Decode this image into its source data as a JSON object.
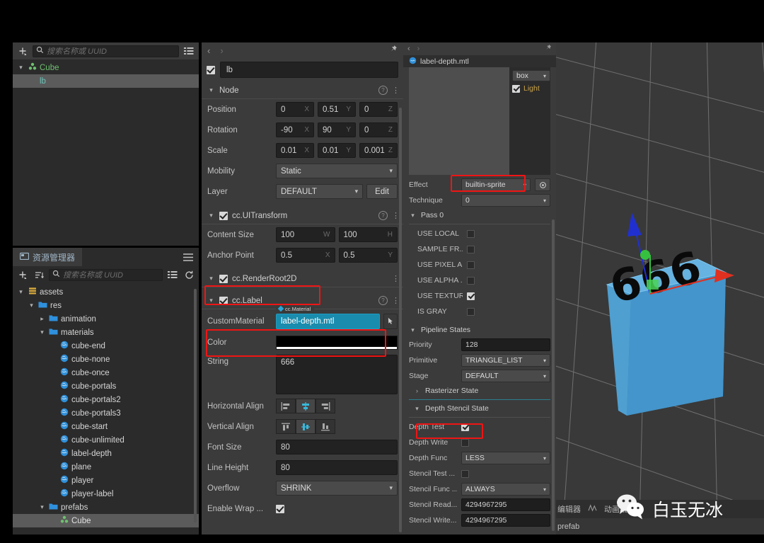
{
  "app": {
    "title": "Cocos Creator Editor"
  },
  "hierarchy": {
    "search_placeholder": "搜索名称或 UUID",
    "add_icon": "plus-icon",
    "search_icon": "search-icon",
    "list_icon": "list-view-icon",
    "nodes": [
      {
        "label": "Cube",
        "icon": "node-icon",
        "arrow": "chevron-down",
        "depth": 0,
        "selected": false
      },
      {
        "label": "lb",
        "icon": "",
        "arrow": "",
        "depth": 1,
        "selected": true
      }
    ]
  },
  "assets": {
    "tab_label": "资源管理器",
    "menu_icon": "hamburger-icon",
    "search_placeholder": "搜索名称或 UUID",
    "add_icon": "plus-icon",
    "sort_icon": "sort-icon",
    "search_icon": "search-icon",
    "list_icon": "list-view-icon",
    "refresh_icon": "refresh-icon",
    "tree": [
      {
        "label": "assets",
        "icon": "assets-icon",
        "arrow": "chevron-down",
        "depth": 0,
        "selected": false
      },
      {
        "label": "res",
        "icon": "folder-icon",
        "arrow": "chevron-down",
        "depth": 1,
        "selected": false
      },
      {
        "label": "animation",
        "icon": "folder-icon",
        "arrow": "chevron-right",
        "depth": 2,
        "selected": false
      },
      {
        "label": "materials",
        "icon": "folder-icon",
        "arrow": "chevron-down",
        "depth": 2,
        "selected": false
      },
      {
        "label": "cube-end",
        "icon": "material-icon",
        "arrow": "",
        "depth": 3,
        "selected": false
      },
      {
        "label": "cube-none",
        "icon": "material-icon",
        "arrow": "",
        "depth": 3,
        "selected": false
      },
      {
        "label": "cube-once",
        "icon": "material-icon",
        "arrow": "",
        "depth": 3,
        "selected": false
      },
      {
        "label": "cube-portals",
        "icon": "material-icon",
        "arrow": "",
        "depth": 3,
        "selected": false
      },
      {
        "label": "cube-portals2",
        "icon": "material-icon",
        "arrow": "",
        "depth": 3,
        "selected": false
      },
      {
        "label": "cube-portals3",
        "icon": "material-icon",
        "arrow": "",
        "depth": 3,
        "selected": false
      },
      {
        "label": "cube-start",
        "icon": "material-icon",
        "arrow": "",
        "depth": 3,
        "selected": false
      },
      {
        "label": "cube-unlimited",
        "icon": "material-icon",
        "arrow": "",
        "depth": 3,
        "selected": false
      },
      {
        "label": "label-depth",
        "icon": "material-icon",
        "arrow": "",
        "depth": 3,
        "selected": false
      },
      {
        "label": "plane",
        "icon": "material-icon",
        "arrow": "",
        "depth": 3,
        "selected": false
      },
      {
        "label": "player",
        "icon": "material-icon",
        "arrow": "",
        "depth": 3,
        "selected": false
      },
      {
        "label": "player-label",
        "icon": "material-icon",
        "arrow": "",
        "depth": 3,
        "selected": false
      },
      {
        "label": "prefabs",
        "icon": "folder-icon",
        "arrow": "chevron-down",
        "depth": 2,
        "selected": false
      },
      {
        "label": "Cube",
        "icon": "node-icon",
        "arrow": "",
        "depth": 3,
        "selected": true
      }
    ]
  },
  "inspector": {
    "back_icon": "chevron-left-icon",
    "forward_icon": "chevron-right-icon",
    "pin_icon": "pin-icon",
    "node_name": "lb",
    "node_enabled": true,
    "node_section": {
      "title": "Node",
      "help_icon": "help-icon",
      "menu_icon": "kebab-menu-icon",
      "rows": [
        {
          "label": "Position",
          "type": "vec3",
          "values": [
            "0",
            "0.51",
            "0"
          ],
          "axes": [
            "X",
            "Y",
            "Z"
          ]
        },
        {
          "label": "Rotation",
          "type": "vec3",
          "values": [
            "-90",
            "90",
            "0"
          ],
          "axes": [
            "X",
            "Y",
            "Z"
          ]
        },
        {
          "label": "Scale",
          "type": "vec3",
          "values": [
            "0.01",
            "0.01",
            "0.001"
          ],
          "axes": [
            "X",
            "Y",
            "Z"
          ]
        }
      ],
      "mobility_label": "Mobility",
      "mobility_value": "Static",
      "layer_label": "Layer",
      "layer_value": "DEFAULT",
      "layer_edit_label": "Edit"
    },
    "uitransform": {
      "title": "cc.UITransform",
      "enabled": true,
      "content_size_label": "Content Size",
      "content_size": [
        "100",
        "100"
      ],
      "content_size_axes": [
        "W",
        "H"
      ],
      "anchor_label": "Anchor Point",
      "anchor": [
        "0.5",
        "0.5"
      ],
      "anchor_axes": [
        "X",
        "Y"
      ]
    },
    "renderroot2d": {
      "title": "cc.RenderRoot2D",
      "enabled": true,
      "highlighted": true
    },
    "label": {
      "title": "cc.Label",
      "enabled": true,
      "custom_material_label": "CustomMaterial",
      "custom_material_value": "label-depth.mtl",
      "custom_material_tooltip": "cc.Material",
      "custom_material_highlighted": true,
      "color_label": "Color",
      "color_value": "#000000",
      "string_label": "String",
      "string_value": "666",
      "h_align_label": "Horizontal Align",
      "h_align_selected": 1,
      "v_align_label": "Vertical Align",
      "v_align_selected": 1,
      "font_size_label": "Font Size",
      "font_size_value": "80",
      "line_height_label": "Line Height",
      "line_height_value": "80",
      "overflow_label": "Overflow",
      "overflow_value": "SHRINK",
      "enable_wrap_label": "Enable Wrap ...",
      "enable_wrap_value": true
    }
  },
  "material_panel": {
    "back_icon": "chevron-left-icon",
    "forward_icon": "chevron-right-icon",
    "pin_icon": "pin-icon",
    "asset_name": "label-depth.mtl",
    "asset_icon": "material-icon",
    "preview_shape": "box",
    "light_label": "Light",
    "light_enabled": true,
    "effect_label": "Effect",
    "effect_value": "builtin-sprite",
    "effect_highlighted": true,
    "effect_locate_icon": "target-icon",
    "technique_label": "Technique",
    "technique_value": "0",
    "pass_title": "Pass 0",
    "defines": [
      {
        "label": "USE LOCAL",
        "value": false
      },
      {
        "label": "SAMPLE FR...",
        "value": false
      },
      {
        "label": "USE PIXEL A...",
        "value": false
      },
      {
        "label": "USE ALPHA ...",
        "value": false
      },
      {
        "label": "USE TEXTURE",
        "value": true
      },
      {
        "label": "IS GRAY",
        "value": false
      }
    ],
    "pipeline_title": "Pipeline States",
    "priority_label": "Priority",
    "priority_value": "128",
    "primitive_label": "Primitive",
    "primitive_value": "TRIANGLE_LIST",
    "stage_label": "Stage",
    "stage_value": "DEFAULT",
    "rasterizer_title": "Rasterizer State",
    "depth_stencil_title": "Depth Stencil State",
    "depth_test_label": "Depth Test",
    "depth_test_value": true,
    "depth_test_highlighted": true,
    "depth_write_label": "Depth Write",
    "depth_write_value": false,
    "depth_func_label": "Depth Func",
    "depth_func_value": "LESS",
    "stencil_test_label": "Stencil Test ...",
    "stencil_test_value": false,
    "stencil_func_label": "Stencil Func ...",
    "stencil_func_value": "ALWAYS",
    "stencil_read_label": "Stencil Read...",
    "stencil_read_value": "4294967295",
    "stencil_write_label": "Stencil Write...",
    "stencil_write_value": "4294967295"
  },
  "viewport": {
    "cube_label": "666",
    "gizmo": {
      "x_axis_color": "#e03020",
      "y_axis_color": "#36c040",
      "z_axis_color": "#2030d0"
    },
    "cube_color": "#4aa3d8",
    "grid_color": "#9a9a9a",
    "bg_color": "#393939"
  },
  "statusbar": {
    "item_editor": "编辑器",
    "item_anim_icon": "animation-icon",
    "item_anim": "动画编",
    "breadcrumb": "prefab"
  },
  "watermark": {
    "icon": "wechat-icon",
    "text": "白玉无冰"
  }
}
